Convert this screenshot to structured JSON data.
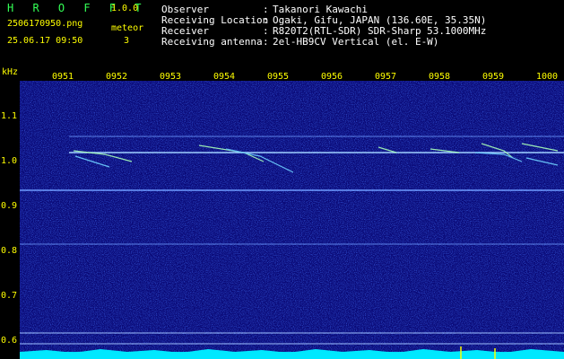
{
  "app": {
    "name": "H R O F F T",
    "version": "1.0.0"
  },
  "file": {
    "name": "2506170950.png",
    "datetime": "25.06.17 09:50"
  },
  "meteor": {
    "label": "meteor",
    "count": "3"
  },
  "info": [
    {
      "key": "Observer",
      "value": "Takanori Kawachi"
    },
    {
      "key": "Receiving Location",
      "value": "Ogaki, Gifu, JAPAN (136.60E, 35.35N)"
    },
    {
      "key": "Receiver",
      "value": "R820T2(RTL-SDR) SDR-Sharp 53.1000MHz"
    },
    {
      "key": "Receiving antenna",
      "value": "2el-HB9CV Vertical (el. E-W)"
    }
  ],
  "info_separator": ":",
  "axis": {
    "y_unit": "kHz",
    "y_ticks": [
      "1.1",
      "1.0",
      "0.9",
      "0.8",
      "0.7",
      "0.6"
    ],
    "x_ticks": [
      "0951",
      "0952",
      "0953",
      "0954",
      "0955",
      "0956",
      "0957",
      "0958",
      "0959",
      "1000"
    ]
  },
  "colors": {
    "label_yellow": "#ffff00",
    "label_green": "#33ff55",
    "background_noise": "#0a0a78",
    "carrier_line": "#7fb0ff",
    "meteor_trail": "#a0ffb0",
    "baseline_cyan": "#00e5ff"
  }
}
